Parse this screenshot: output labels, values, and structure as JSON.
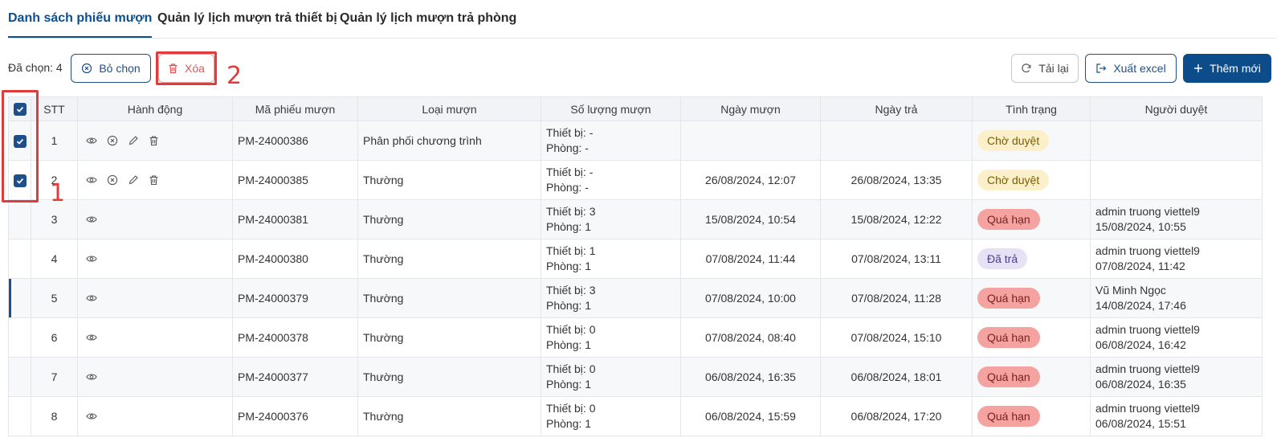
{
  "tabs": [
    {
      "label": "Danh sách phiếu mượn",
      "active": true
    },
    {
      "label": "Quản lý lịch mượn trả thiết bị",
      "active": false
    },
    {
      "label": "Quản lý lịch mượn trả phòng",
      "active": false
    }
  ],
  "toolbar": {
    "selected_text": "Đã chọn: 4",
    "deselect_label": "Bỏ chọn",
    "delete_label": "Xóa",
    "reload_label": "Tải lại",
    "export_label": "Xuất excel",
    "add_label": "Thêm mới"
  },
  "annotations": {
    "one": "1",
    "two": "2"
  },
  "colors": {
    "accent": "#0d4c8b",
    "annotation": "#e23b3b",
    "status_pending_bg": "#fbf0c9",
    "status_pending_fg": "#7a5d00",
    "status_overdue_bg": "#f4a3a0",
    "status_overdue_fg": "#7a1f1f",
    "status_returned_bg": "#e6e1f5",
    "status_returned_fg": "#4b3d86"
  },
  "table": {
    "headers": [
      "STT",
      "Hành động",
      "Mã phiếu mượn",
      "Loại mượn",
      "Số lượng mượn",
      "Ngày mượn",
      "Ngày trả",
      "Tình trạng",
      "Người duyệt"
    ],
    "rows": [
      {
        "stt": "1",
        "checked": true,
        "actions": [
          "eye-icon",
          "cancel-icon",
          "edit-icon",
          "trash-icon"
        ],
        "code": "PM-24000386",
        "type": "Phân phối chương trình",
        "qty_device": "Thiết bị: -",
        "qty_room": "Phòng: -",
        "borrow_date": "",
        "return_date": "",
        "status": "Chờ duyệt",
        "status_kind": "pending",
        "approver_name": "",
        "approver_date": ""
      },
      {
        "stt": "2",
        "checked": true,
        "actions": [
          "eye-icon",
          "cancel-icon",
          "edit-icon",
          "trash-icon"
        ],
        "code": "PM-24000385",
        "type": "Thường",
        "qty_device": "Thiết bị: -",
        "qty_room": "Phòng: -",
        "borrow_date": "26/08/2024, 12:07",
        "return_date": "26/08/2024, 13:35",
        "status": "Chờ duyệt",
        "status_kind": "pending",
        "approver_name": "",
        "approver_date": ""
      },
      {
        "stt": "3",
        "checked": false,
        "actions": [
          "eye-icon"
        ],
        "code": "PM-24000381",
        "type": "Thường",
        "qty_device": "Thiết bị: 3",
        "qty_room": "Phòng: 1",
        "borrow_date": "15/08/2024, 10:54",
        "return_date": "15/08/2024, 12:22",
        "status": "Quá hạn",
        "status_kind": "overdue",
        "approver_name": "admin truong viettel9",
        "approver_date": "15/08/2024, 10:55"
      },
      {
        "stt": "4",
        "checked": false,
        "actions": [
          "eye-icon"
        ],
        "code": "PM-24000380",
        "type": "Thường",
        "qty_device": "Thiết bị: 1",
        "qty_room": "Phòng: 1",
        "borrow_date": "07/08/2024, 11:44",
        "return_date": "07/08/2024, 13:11",
        "status": "Đã trả",
        "status_kind": "returned",
        "approver_name": "admin truong viettel9",
        "approver_date": "07/08/2024, 11:42"
      },
      {
        "stt": "5",
        "checked": false,
        "focused": true,
        "actions": [
          "eye-icon"
        ],
        "code": "PM-24000379",
        "type": "Thường",
        "qty_device": "Thiết bị: 3",
        "qty_room": "Phòng: 1",
        "borrow_date": "07/08/2024, 10:00",
        "return_date": "07/08/2024, 11:28",
        "status": "Quá hạn",
        "status_kind": "overdue",
        "approver_name": "Vũ Minh Ngọc",
        "approver_date": "14/08/2024, 17:46"
      },
      {
        "stt": "6",
        "checked": false,
        "actions": [
          "eye-icon"
        ],
        "code": "PM-24000378",
        "type": "Thường",
        "qty_device": "Thiết bị: 0",
        "qty_room": "Phòng: 1",
        "borrow_date": "07/08/2024, 08:40",
        "return_date": "07/08/2024, 15:10",
        "status": "Quá hạn",
        "status_kind": "overdue",
        "approver_name": "admin truong viettel9",
        "approver_date": "06/08/2024, 16:42"
      },
      {
        "stt": "7",
        "checked": false,
        "actions": [
          "eye-icon"
        ],
        "code": "PM-24000377",
        "type": "Thường",
        "qty_device": "Thiết bị: 0",
        "qty_room": "Phòng: 1",
        "borrow_date": "06/08/2024, 16:35",
        "return_date": "06/08/2024, 18:01",
        "status": "Quá hạn",
        "status_kind": "overdue",
        "approver_name": "admin truong viettel9",
        "approver_date": "06/08/2024, 16:35"
      },
      {
        "stt": "8",
        "checked": false,
        "actions": [
          "eye-icon"
        ],
        "code": "PM-24000376",
        "type": "Thường",
        "qty_device": "Thiết bị: 0",
        "qty_room": "Phòng: 1",
        "borrow_date": "06/08/2024, 15:59",
        "return_date": "06/08/2024, 17:20",
        "status": "Quá hạn",
        "status_kind": "overdue",
        "approver_name": "admin truong viettel9",
        "approver_date": "06/08/2024, 15:51"
      }
    ]
  }
}
